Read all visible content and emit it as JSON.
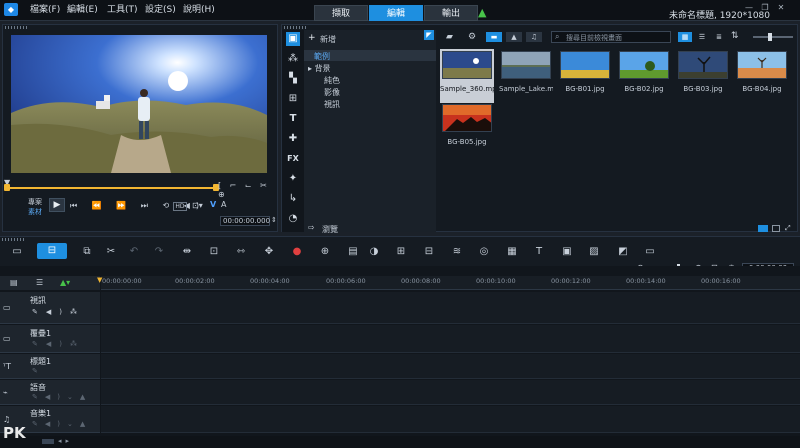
{
  "app": {
    "project_title": "未命名標題, 1920*1080",
    "menu": [
      "檔案(F)",
      "編輯(E)",
      "工具(T)",
      "設定(S)",
      "說明(H)"
    ],
    "tabs": [
      "擷取",
      "編輯",
      "輸出"
    ],
    "active_tab": "編輯"
  },
  "preview": {
    "timecode": "00:00:00.000",
    "mode_project": "專案",
    "mode_clip": "素材",
    "timecode_label": "00:00:00.000"
  },
  "library": {
    "add_label": "新增",
    "tree": [
      "範例",
      "背景",
      "純色",
      "影像",
      "視訊"
    ],
    "browse_label": "瀏覽",
    "search_placeholder": "搜尋目前檢視畫面",
    "thumbnails": [
      {
        "name": "Sample_360.mp4"
      },
      {
        "name": "Sample_Lake.m..."
      },
      {
        "name": "BG-B01.jpg"
      },
      {
        "name": "BG-B02.jpg"
      },
      {
        "name": "BG-B03.jpg"
      },
      {
        "name": "BG-B04.jpg"
      },
      {
        "name": "BG-B05.jpg"
      }
    ]
  },
  "timeline": {
    "timecode": "0:00:00:00",
    "ruler": [
      "00:00:00:00",
      "00:00:02:00",
      "00:00:04:00",
      "00:00:06:00",
      "00:00:08:00",
      "00:00:10:00",
      "00:00:12:00",
      "00:00:14:00",
      "00:00:16:00"
    ],
    "tracks": [
      "視訊",
      "覆疊1",
      "標題1",
      "語音",
      "音樂1"
    ]
  },
  "watermark": "PK"
}
